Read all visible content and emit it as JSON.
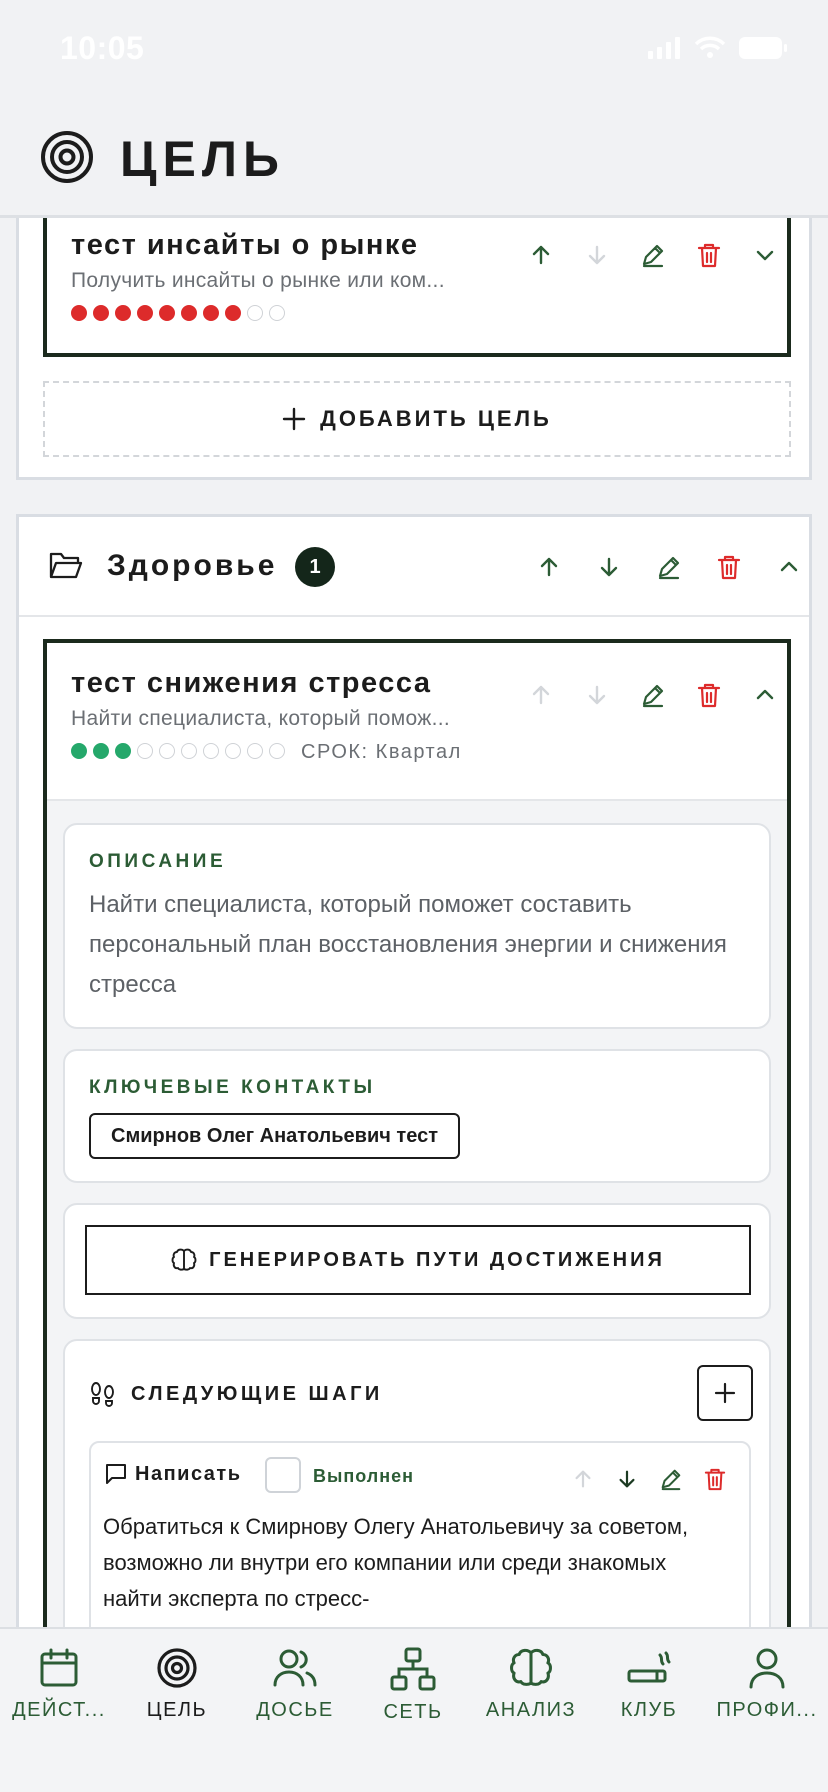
{
  "status_bar": {
    "time": "10:05"
  },
  "header": {
    "title": "ЦЕЛЬ",
    "icon": "target-icon"
  },
  "colors": {
    "accent_green": "#2c5c35",
    "dark_green": "#14261a",
    "danger_red": "#dd2b2b",
    "progress_green": "#25a86b",
    "background": "#f1f2f4"
  },
  "previous_section": {
    "goal": {
      "title": "тест инсайты о рынке",
      "subtitle": "Получить инсайты о рынке или ком...",
      "progress": {
        "filled": 8,
        "total": 10,
        "color": "red"
      }
    },
    "add_goal_label": "ДОБАВИТЬ ЦЕЛЬ"
  },
  "section": {
    "title": "Здоровье",
    "count": "1",
    "goal": {
      "title": "тест снижения стресса",
      "subtitle": "Найти специалиста, который помож...",
      "progress": {
        "filled": 3,
        "total": 10,
        "color": "green"
      },
      "deadline_label": "СРОК: Квартал",
      "description_label": "ОПИСАНИЕ",
      "description": "Найти специалиста, который поможет составить персональный план восстановления энергии и снижения стресса",
      "contacts_label": "КЛЮЧЕВЫЕ КОНТАКТЫ",
      "contacts": [
        "Смирнов Олег Анатольевич тест"
      ],
      "generate_label": "ГЕНЕРИРОВАТЬ ПУТИ ДОСТИЖЕНИЯ",
      "next_steps_label": "СЛЕДУЮЩИЕ ШАГИ",
      "steps": [
        {
          "type": "Написать",
          "status": "Выполнен",
          "done": false,
          "text": "Обратиться к Смирнову Олегу Анатольевичу за советом, возможно ли внутри его компании или среди знакомых найти эксперта по стресс-"
        }
      ]
    }
  },
  "bottom_nav": [
    {
      "label": "ДЕЙСТ...",
      "icon": "calendar-icon",
      "active": false
    },
    {
      "label": "ЦЕЛЬ",
      "icon": "target-icon",
      "active": true
    },
    {
      "label": "ДОСЬЕ",
      "icon": "users-icon",
      "active": false
    },
    {
      "label": "СЕТЬ",
      "icon": "network-icon",
      "active": false
    },
    {
      "label": "АНАЛИЗ",
      "icon": "brain-icon",
      "active": false
    },
    {
      "label": "КЛУБ",
      "icon": "cigar-icon",
      "active": false
    },
    {
      "label": "ПРОФИ...",
      "icon": "profile-icon",
      "active": false
    }
  ]
}
